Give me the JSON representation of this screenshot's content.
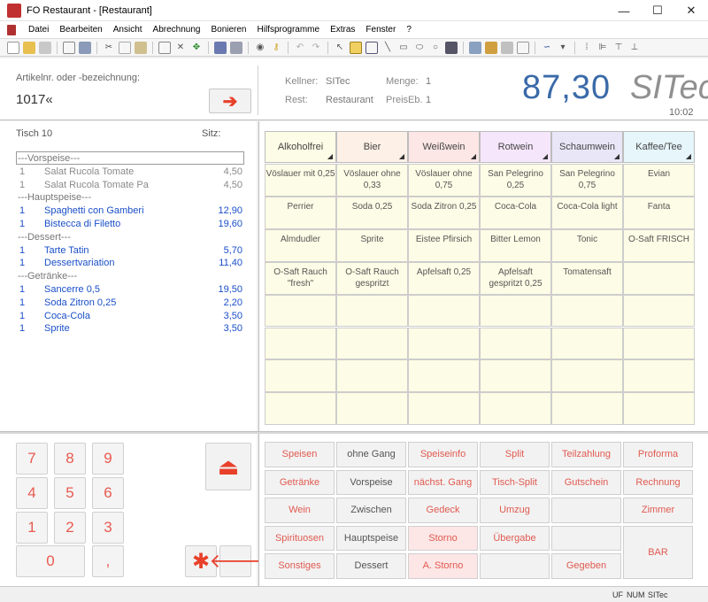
{
  "window": {
    "title": "FO Restaurant - [Restaurant]",
    "minimize": "—",
    "maximize": "☐",
    "close": "✕"
  },
  "menu": [
    "Datei",
    "Bearbeiten",
    "Ansicht",
    "Abrechnung",
    "Bonieren",
    "Hilfsprogramme",
    "Extras",
    "Fenster",
    "?"
  ],
  "info": {
    "article_label": "Artikelnr. oder -bezeichnung:",
    "article_value": "1017«",
    "enter_glyph": "➔",
    "kellner_label": "Kellner:",
    "kellner_value": "SITec",
    "menge_label": "Menge:",
    "menge_value": "1",
    "rest_label": "Rest:",
    "rest_value": "Restaurant",
    "preis_label": "PreisEb.",
    "preis_value": "1",
    "total": "87,30",
    "brand": "SITec",
    "time": "10:02"
  },
  "order": {
    "table_label": "Tisch 10",
    "seat_label": "Sitz:",
    "lines": [
      {
        "type": "group",
        "name": "---Vorspeise---"
      },
      {
        "type": "old",
        "qty": "1",
        "name": "Salat Rucola Tomate",
        "price": "4,50"
      },
      {
        "type": "old",
        "qty": "1",
        "name": "Salat Rucola Tomate Pa",
        "price": "4,50"
      },
      {
        "type": "group",
        "name": "---Hauptspeise---"
      },
      {
        "type": "new",
        "qty": "1",
        "name": "Spaghetti con Gamberi",
        "price": "12,90"
      },
      {
        "type": "new",
        "qty": "1",
        "name": "Bistecca di Filetto",
        "price": "19,60"
      },
      {
        "type": "group",
        "name": "---Dessert---"
      },
      {
        "type": "new",
        "qty": "1",
        "name": "Tarte Tatin",
        "price": "5,70"
      },
      {
        "type": "new",
        "qty": "1",
        "name": "Dessertvariation",
        "price": "11,40"
      },
      {
        "type": "group",
        "name": "---Getränke---"
      },
      {
        "type": "new",
        "qty": "1",
        "name": "Sancerre 0,5",
        "price": "19,50"
      },
      {
        "type": "new",
        "qty": "1",
        "name": "Soda Zitron 0,25",
        "price": "2,20"
      },
      {
        "type": "new",
        "qty": "1",
        "name": "Coca-Cola",
        "price": "3,50"
      },
      {
        "type": "new",
        "qty": "1",
        "name": "Sprite",
        "price": "3,50"
      }
    ]
  },
  "categories": [
    {
      "label": "Alkoholfrei",
      "color": "#fdfce6"
    },
    {
      "label": "Bier",
      "color": "#fdf0e6"
    },
    {
      "label": "Weißwein",
      "color": "#fde6e6"
    },
    {
      "label": "Rotwein",
      "color": "#f6e6fb"
    },
    {
      "label": "Schaumwein",
      "color": "#e9e6f8"
    },
    {
      "label": "Kaffee/Tee",
      "color": "#e6f6fb"
    }
  ],
  "articles": [
    [
      "Vöslauer mit 0,25",
      "Vöslauer ohne 0,33",
      "Vöslauer ohne 0,75",
      "San Pelegrino 0,25",
      "San Pelegrino 0,75",
      "Evian"
    ],
    [
      "Perrier",
      "Soda 0,25",
      "Soda Zitron 0,25",
      "Coca-Cola",
      "Coca-Cola light",
      "Fanta"
    ],
    [
      "Almdudler",
      "Sprite",
      "Eistee Pfirsich",
      "Bitter Lemon",
      "Tonic",
      "O-Saft FRISCH"
    ],
    [
      "O-Saft Rauch \"fresh\"",
      "O-Saft Rauch gespritzt",
      "Apfelsaft 0,25",
      "Apfelsaft gespritzt 0,25",
      "Tomatensaft",
      ""
    ],
    [
      "",
      "",
      "",
      "",
      "",
      ""
    ],
    [
      "",
      "",
      "",
      "",
      "",
      ""
    ],
    [
      "",
      "",
      "",
      "",
      "",
      ""
    ],
    [
      "",
      "",
      "",
      "",
      "",
      ""
    ]
  ],
  "keypad": {
    "keys": [
      "7",
      "8",
      "9",
      "4",
      "5",
      "6",
      "1",
      "2",
      "3"
    ],
    "zero": "0",
    "comma": ",",
    "eject": "⏏",
    "star": "✱",
    "back": "🡐"
  },
  "functions": [
    {
      "label": "Speisen",
      "style": "red"
    },
    {
      "label": "ohne Gang",
      "style": "gray"
    },
    {
      "label": "Speiseinfo",
      "style": "red"
    },
    {
      "label": "Split",
      "style": "red"
    },
    {
      "label": "Teilzahlung",
      "style": "red"
    },
    {
      "label": "Proforma",
      "style": "red"
    },
    {
      "label": "Getränke",
      "style": "red"
    },
    {
      "label": "Vorspeise",
      "style": "gray"
    },
    {
      "label": "nächst. Gang",
      "style": "red"
    },
    {
      "label": "Tisch-Split",
      "style": "red"
    },
    {
      "label": "Gutschein",
      "style": "red"
    },
    {
      "label": "Rechnung",
      "style": "red"
    },
    {
      "label": "Wein",
      "style": "red"
    },
    {
      "label": "Zwischen",
      "style": "gray"
    },
    {
      "label": "Gedeck",
      "style": "red"
    },
    {
      "label": "Umzug",
      "style": "red"
    },
    {
      "label": "",
      "style": "red"
    },
    {
      "label": "Zimmer",
      "style": "red"
    },
    {
      "label": "Spirituosen",
      "style": "red"
    },
    {
      "label": "Hauptspeise",
      "style": "gray"
    },
    {
      "label": "Storno",
      "style": "pink"
    },
    {
      "label": "Übergabe",
      "style": "red"
    },
    {
      "label": "",
      "style": "red"
    },
    {
      "label": "BAR",
      "style": "red"
    },
    {
      "label": "Sonstiges",
      "style": "red"
    },
    {
      "label": "Dessert",
      "style": "gray"
    },
    {
      "label": "A. Storno",
      "style": "pink"
    },
    {
      "label": "",
      "style": "red"
    },
    {
      "label": "Gegeben",
      "style": "red"
    }
  ],
  "status": {
    "uf": "UF",
    "num": "NUM",
    "user": "SITec"
  }
}
